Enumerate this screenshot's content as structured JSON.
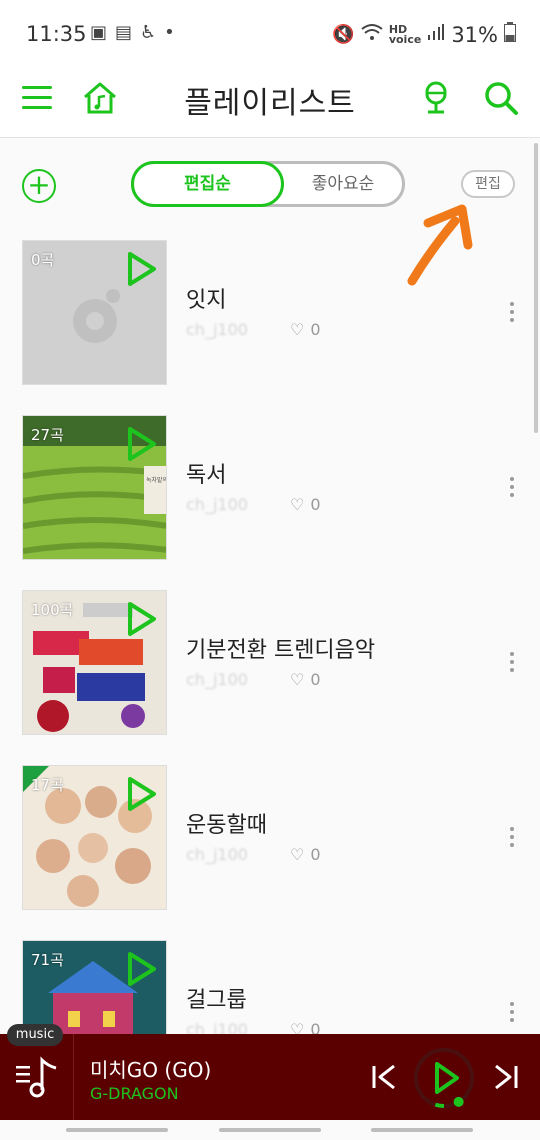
{
  "status_bar": {
    "time": "11:35",
    "left_icons": [
      "gallery-icon",
      "phone-icon",
      "accessibility-icon",
      "dot-icon"
    ],
    "battery": "31%",
    "right_icons": [
      "mute-icon",
      "wifi-icon",
      "hd-voice-icon",
      "signal-icon",
      "battery-icon"
    ]
  },
  "header": {
    "title": "플레이리스트",
    "icons": [
      "menu-icon",
      "home-music-icon",
      "microphone-icon",
      "search-icon"
    ]
  },
  "toolbar": {
    "sort_active": "편집순",
    "sort_inactive": "좋아요순",
    "edit_label": "편집"
  },
  "playlists": [
    {
      "count": "0곡",
      "title": "잇지",
      "owner": "ch_j100",
      "likes": "0"
    },
    {
      "count": "27곡",
      "title": "독서",
      "owner": "ch_j100",
      "likes": "0"
    },
    {
      "count": "100곡",
      "title": "기분전환 트렌디음악",
      "owner": "ch_j100",
      "likes": "0"
    },
    {
      "count": "17곡",
      "title": "운동할때",
      "owner": "ch_j100",
      "likes": "0"
    },
    {
      "count": "71곡",
      "title": "걸그룹",
      "owner": "ch_j100",
      "likes": "0"
    }
  ],
  "covers": {
    "p2_label": "녹차밭의 풍경"
  },
  "player": {
    "tag": "music",
    "song": "미치GO (GO)",
    "artist": "G-DRAGON",
    "progress": 0.05
  },
  "colors": {
    "accent": "#1ec41e",
    "player_bg": "#5a0000",
    "annotation_arrow": "#f07a1a"
  }
}
